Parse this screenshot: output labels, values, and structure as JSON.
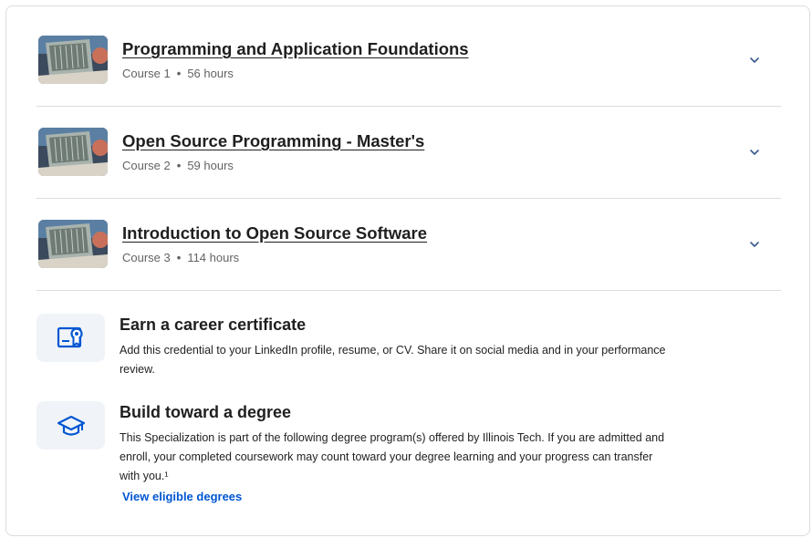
{
  "courses": [
    {
      "title": "Programming and Application Foundations",
      "course_label": "Course 1",
      "hours": "56 hours"
    },
    {
      "title": "Open Source Programming - Master's",
      "course_label": "Course 2",
      "hours": "59 hours"
    },
    {
      "title": "Introduction to Open Source Software",
      "course_label": "Course 3",
      "hours": "114 hours"
    }
  ],
  "certificate": {
    "icon": "certificate-icon",
    "title": "Earn a career certificate",
    "description": "Add this credential to your LinkedIn profile, resume, or CV. Share it on social media and in your performance review."
  },
  "degree": {
    "icon": "graduation-cap-icon",
    "title": "Build toward a degree",
    "description": "This Specialization is part of the following degree program(s) offered by Illinois Tech. If you are admitted and enroll, your completed coursework may count toward your degree learning and your progress can transfer with you.¹",
    "link_label": "View eligible degrees"
  },
  "colors": {
    "accent": "#0056d2",
    "icon_bg": "#f0f4f8",
    "chevron": "#3a5a8c"
  }
}
